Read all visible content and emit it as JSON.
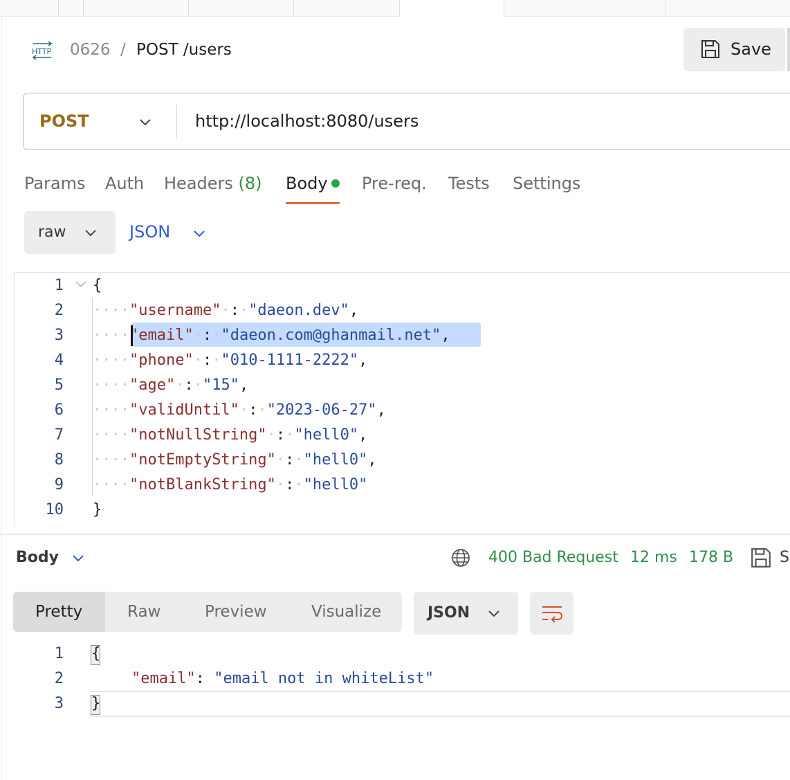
{
  "request": {
    "collection": "0626",
    "breadcrumb_sep": "/",
    "name": "POST /users",
    "save_label": "Save",
    "method": "POST",
    "url": "http://localhost:8080/users"
  },
  "request_tabs": [
    {
      "label": "Params"
    },
    {
      "label": "Auth"
    },
    {
      "label": "Headers",
      "count": "(8)"
    },
    {
      "label": "Body",
      "active": true
    },
    {
      "label": "Pre-req."
    },
    {
      "label": "Tests"
    },
    {
      "label": "Settings"
    }
  ],
  "body_mode": {
    "mode": "raw",
    "language": "JSON"
  },
  "request_body": {
    "line_numbers": [
      "1",
      "2",
      "3",
      "4",
      "5",
      "6",
      "7",
      "8",
      "9",
      "10"
    ],
    "open_brace": "{",
    "close_brace": "}",
    "fields": [
      {
        "key": "\"username\"",
        "value": "\"daeon.dev\"",
        "comma": ","
      },
      {
        "key": "\"email\"",
        "value": "\"daeon.com@ghanmail.net\"",
        "comma": ","
      },
      {
        "key": "\"phone\"",
        "value": "\"010-1111-2222\"",
        "comma": ","
      },
      {
        "key": "\"age\"",
        "value": "\"15\"",
        "comma": ","
      },
      {
        "key": "\"validUntil\"",
        "value": "\"2023-06-27\"",
        "comma": ","
      },
      {
        "key": "\"notNullString\"",
        "value": "\"hell0\"",
        "comma": ","
      },
      {
        "key": "\"notEmptyString\"",
        "value": "\"hell0\"",
        "comma": ","
      },
      {
        "key": "\"notBlankString\"",
        "value": "\"hell0\"",
        "comma": ""
      }
    ]
  },
  "response": {
    "section_label": "Body",
    "status": "400 Bad Request",
    "time": "12 ms",
    "size": "178 B",
    "save_partial": "S",
    "view_tabs": [
      "Pretty",
      "Raw",
      "Preview",
      "Visualize"
    ],
    "active_view": "Pretty",
    "format": "JSON",
    "line_numbers": [
      "1",
      "2",
      "3"
    ],
    "open_brace": "{",
    "close_brace": "}",
    "key": "\"email\"",
    "colon": ":",
    "value": "\"email not in whiteList\""
  },
  "colors": {
    "method": "#9c6b1a",
    "status": "#2f8f46",
    "accent_underline": "#e06a3a",
    "selection": "#c5dbff"
  },
  "icons": [
    "http-icon",
    "save-icon",
    "chevron-down-icon",
    "fold-icon",
    "globe-icon",
    "wrap-lines-icon"
  ]
}
